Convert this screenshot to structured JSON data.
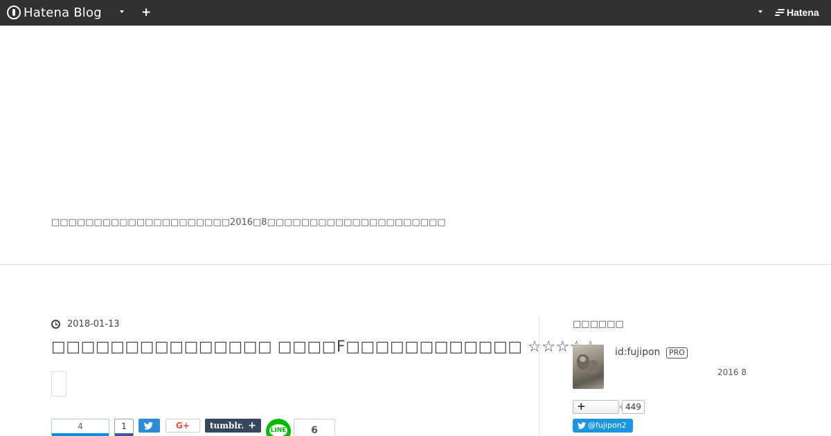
{
  "topbar": {
    "logo_text": "Hatena Blog",
    "add_label": "+",
    "hatena_label": "Hatena",
    "colors": {
      "background": "#313131",
      "text": "#ffffff"
    }
  },
  "header": {
    "description": "□□□□□□□□□□□□□□□□□□□□□2016□8□□□□□□□□□□□□□□□□□□□□□"
  },
  "article": {
    "date": "2018-01-13",
    "title": "□□□□□□□□□□□□□□□ □□□□F□□□□□□□□□□□□ ☆☆☆☆☆",
    "share": {
      "hatena_count": "4",
      "facebook_count": "1",
      "google_plus_label": "G+",
      "tumblr_label": "tumblr.",
      "tumblr_plus": "+",
      "line_label": "LINE",
      "pocket_count": "6",
      "colors": {
        "hatena": "#008fde",
        "facebook": "#3b5998",
        "twitter": "#2b8bd6",
        "google_plus": "#dd4b39",
        "tumblr": "#36465d",
        "line": "#00b900"
      }
    }
  },
  "sidebar": {
    "heading": "□□□□□□",
    "user_id": "id:fujipon",
    "pro_badge": "PRO",
    "since": "2016  8",
    "follow_label": "+",
    "follower_count": "449",
    "twitter_handle": "@fujipon2",
    "colors": {
      "twitter_follow": "#1b95e0"
    }
  }
}
